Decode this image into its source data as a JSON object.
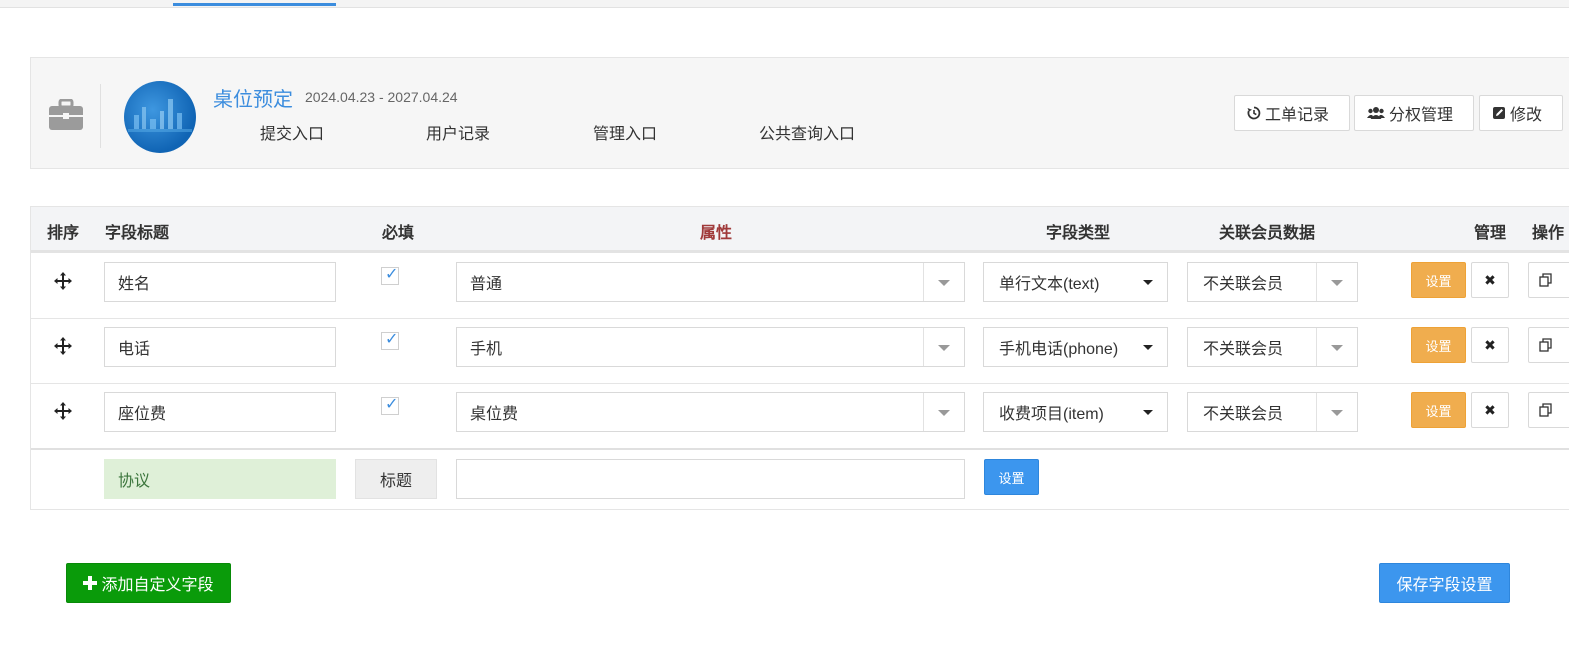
{
  "header": {
    "title": "桌位预定",
    "dates": "2024.04.23 - 2027.04.24",
    "links": [
      {
        "label": "提交入口"
      },
      {
        "label": "用户记录"
      },
      {
        "label": "管理入口"
      },
      {
        "label": "公共查询入口"
      }
    ],
    "buttons": {
      "records": "工单记录",
      "permissions": "分权管理",
      "edit": "修改"
    }
  },
  "table": {
    "columns": {
      "sort": "排序",
      "field_title": "字段标题",
      "required": "必填",
      "attribute": "属性",
      "field_type": "字段类型",
      "member_data": "关联会员数据",
      "manage": "管理",
      "action": "操作"
    },
    "rows": [
      {
        "title": "姓名",
        "required": "✓",
        "attribute": "普通",
        "type": "单行文本(text)",
        "member": "不关联会员",
        "set_label": "设置",
        "delete_label": "✖"
      },
      {
        "title": "电话",
        "required": "✓",
        "attribute": "手机",
        "type": "手机电话(phone)",
        "member": "不关联会员",
        "set_label": "设置",
        "delete_label": "✖"
      },
      {
        "title": "座位费",
        "required": "✓",
        "attribute": "桌位费",
        "type": "收费项目(item)",
        "member": "不关联会员",
        "set_label": "设置",
        "delete_label": "✖"
      }
    ],
    "agreement_row": {
      "title": "协议",
      "tag": "标题",
      "attribute": "",
      "set_label": "设置"
    }
  },
  "footer": {
    "add_field": "添加自定义字段",
    "save": "保存字段设置"
  },
  "colors": {
    "accent": "#3c8dde",
    "warning": "#f0ad4e",
    "success": "#0a9b0a",
    "primary_button": "#3c96ee"
  }
}
